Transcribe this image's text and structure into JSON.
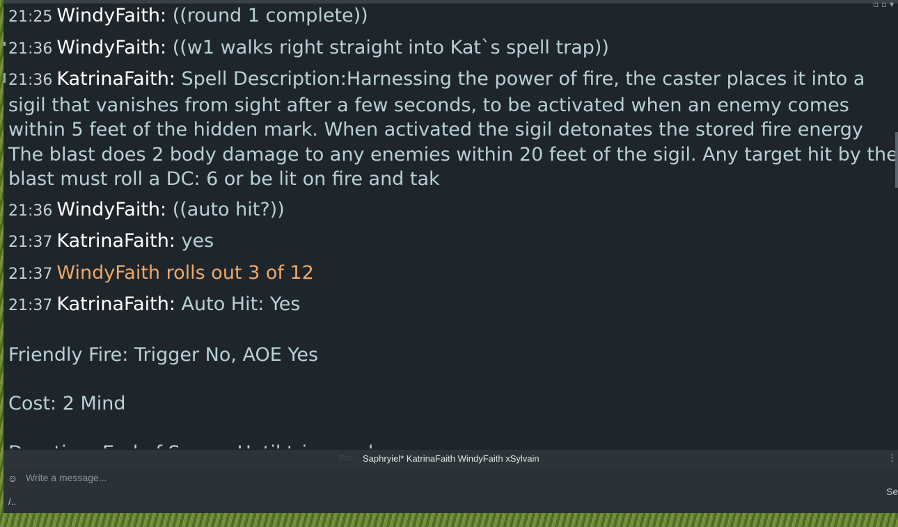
{
  "messages": [
    {
      "time": "21:25",
      "user": "WindyFaith:",
      "text": "((round 1 complete))",
      "type": "chat"
    },
    {
      "time": "21:36",
      "user": "WindyFaith:",
      "text": "((w1 walks right straight into Kat`s spell trap))",
      "type": "chat"
    },
    {
      "time": "21:36",
      "user": "KatrinaFaith:",
      "text": "Spell Description:Harnessing the power of fire, the caster places it into a sigil that vanishes from sight after a few seconds, to be activated when an enemy comes within 5 feet of the hidden mark. When activated the sigil detonates the stored fire energy The blast does 2 body damage to any enemies within 20 feet of the sigil. Any target hit by the blast must roll a DC: 6 or be lit on fire and tak",
      "type": "chat"
    },
    {
      "time": "21:36",
      "user": "WindyFaith:",
      "text": "((auto hit?))",
      "type": "chat"
    },
    {
      "time": "21:37",
      "user": "KatrinaFaith:",
      "text": "yes",
      "type": "chat"
    },
    {
      "time": "21:37",
      "user": "",
      "text": "WindyFaith rolls out 3 of 12",
      "type": "roll"
    },
    {
      "time": "21:37",
      "user": "KatrinaFaith:",
      "text": "Auto Hit: Yes",
      "type": "chat"
    }
  ],
  "continuation": [
    "Friendly Fire: Trigger No, AOE Yes",
    "Cost: 2 Mind",
    "Duration: End of Scene, Until triggered"
  ],
  "userbar": {
    "eco_label": "Eco",
    "users": "Saphryiel* KatrinaFaith WindyFaith xSylvain"
  },
  "input": {
    "placeholder": "Write a message...",
    "emoji_icon": "smiley-icon",
    "command_hint": "/..",
    "send_label": "Sen"
  },
  "colors": {
    "background": "#1f262b",
    "username": "#ffffff",
    "text": "#b9cfd6",
    "roll": "#f0a86a"
  }
}
